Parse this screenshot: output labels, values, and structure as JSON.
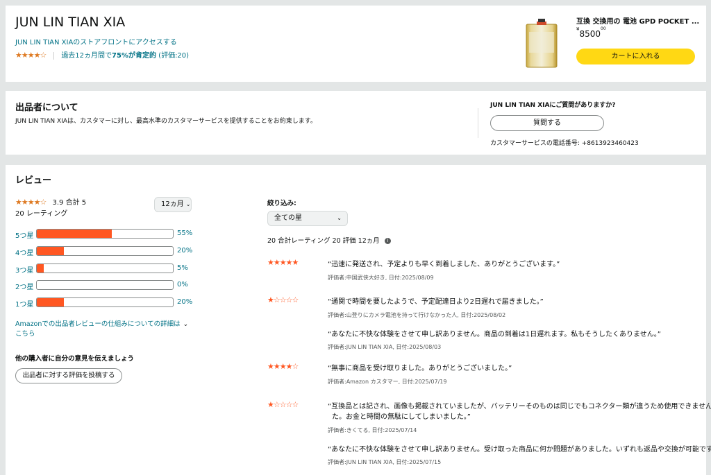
{
  "seller": {
    "name": "JUN LIN TIAN XIA",
    "storefront_link": "JUN LIN TIAN XIAのストアフロントにアクセスする",
    "stars_display": "★★★★☆",
    "rating_summary_pre": "過去12ヵ月間で",
    "rating_summary_bold": "75%が肯定的",
    "rating_summary_post": " (評価:20)"
  },
  "product": {
    "title": "互換 交換用の 電池 GPD POCKET ...",
    "price_currency": "¥",
    "price_main": "8500",
    "price_fraction": "00",
    "add_to_cart": "カートに入れる"
  },
  "about": {
    "heading": "出品者について",
    "body": "JUN LIN TIAN XIAは、カスタマーに対し、最高水準のカスタマーサービスを提供することをお約束します。",
    "question_heading": "JUN LIN TIAN XIAにご質問がありますか?",
    "ask_button": "質問する",
    "phone": "カスタマーサービスの電話番号: +8613923460423"
  },
  "reviews": {
    "heading": "レビュー",
    "avg_stars": "★★★★☆",
    "avg_text": "3.9 合計 5",
    "rating_count": "20 レーティング",
    "period_select": "12ヵ月",
    "histogram": [
      {
        "label": "5つ星",
        "percent": 55,
        "pct_text": "55%"
      },
      {
        "label": "4つ星",
        "percent": 20,
        "pct_text": "20%"
      },
      {
        "label": "3つ星",
        "percent": 5,
        "pct_text": "5%"
      },
      {
        "label": "2つ星",
        "percent": 0,
        "pct_text": "0%"
      },
      {
        "label": "1つ星",
        "percent": 20,
        "pct_text": "20%"
      }
    ],
    "how_it_works_line1": "Amazonでの出品者レビューの仕組みについての詳細は",
    "how_it_works_line2": "こちら",
    "share_heading": "他の購入者に自分の意見を伝えましょう",
    "write_review_button": "出品者に対する評価を投稿する",
    "filter_label": "絞り込み:",
    "filter_select": "全ての星",
    "summary": "20 合計レーティング 20 評価 12ヵ月",
    "items": [
      {
        "stars": "★★★★★",
        "text": "“迅速に発送され、予定よりも早く到着しました、ありがとうございます。”",
        "meta": "評価者:中国武侠大好き, 日付:2025/08/09"
      },
      {
        "stars": "★☆☆☆☆",
        "text": "“通関で時間を要したようで、予定配達日より2日遅れで届きました。”",
        "meta": "評価者:山登りにカメラ電池を持って行けなかった人, 日付:2025/08/02",
        "reply_text": "“あなたに不快な体験をさせて申し訳ありません。商品の到着は1日遅れます。私もそうしたくありません。”",
        "reply_meta": "評価者:JUN LIN TIAN XIA, 日付:2025/08/03"
      },
      {
        "stars": "★★★★☆",
        "text": "“無事に商品を受け取りました。ありがとうございました。”",
        "meta": "評価者:Amazon カスタマー, 日付:2025/07/19"
      },
      {
        "stars": "★☆☆☆☆",
        "text": "“互換品とは記され、画像も掲載されていましたが、バッテリーそのものは同じでもコネクター類が違うため使用できませんでした。お金と時間の無駄にしてしまいました。”",
        "text_line1": "“互換品とは記され、画像も掲載されていましたが、バッテリーそのものは同じでもコネクター類が違うため使用できませんでし",
        "text_line2": "た。お金と時間の無駄にしてしまいました。”",
        "meta": "評価者:きくてる, 日付:2025/07/14",
        "reply_text": "“あなたに不快な体験をさせて申し訳ありません。受け取った商品に何か問題がありました。いずれも返品や交換が可能です。”",
        "reply_meta": "評価者:JUN LIN TIAN XIA, 日付:2025/07/15"
      }
    ]
  }
}
